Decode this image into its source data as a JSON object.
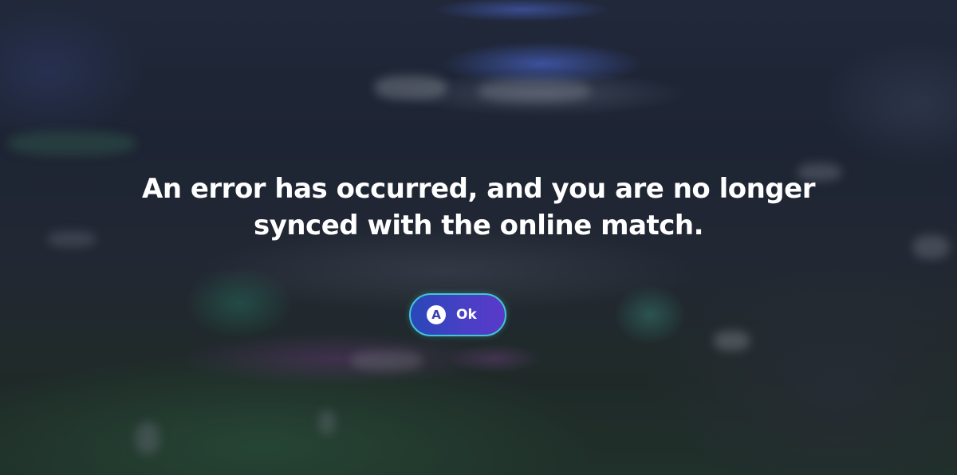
{
  "dialog": {
    "message_line1": "An error has occurred, and you are no longer",
    "message_line2": "synced with the online match."
  },
  "ok_button": {
    "controller_glyph": "A",
    "label": "Ok"
  },
  "colors": {
    "button_border": "#41c7d4",
    "button_fill_start": "#2848b8",
    "button_fill_end": "#5a3ac8",
    "text": "#ffffff"
  },
  "icons": {
    "controller_button": "a-button-icon"
  }
}
